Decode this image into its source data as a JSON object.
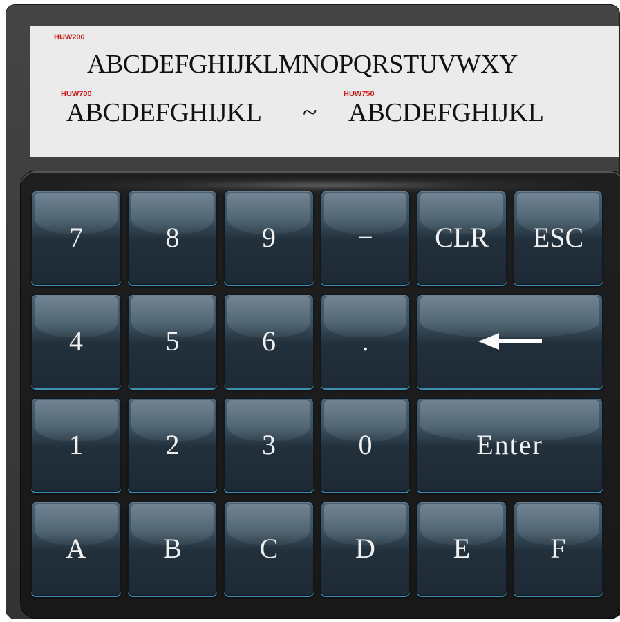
{
  "display": {
    "line1_tag": "HUW200",
    "line1_text": "ABCDEFGHIJKLMNOPQRSTUVWXY",
    "line2_left_tag": "HUW700",
    "line2_left_text": "ABCDEFGHIJKL",
    "line2_separator": "~",
    "line2_right_tag": "HUW750",
    "line2_right_text": "ABCDEFGHIJKL"
  },
  "keys": {
    "k7": "7",
    "k8": "8",
    "k9": "9",
    "minus": "−",
    "clr": "CLR",
    "esc": "ESC",
    "k4": "4",
    "k5": "5",
    "k6": "6",
    "dot": ".",
    "backspace_icon": "left-arrow-icon",
    "k1": "1",
    "k2": "2",
    "k3": "3",
    "k0": "0",
    "enter": "Enter",
    "a": "A",
    "b": "B",
    "c": "C",
    "d": "D",
    "e": "E",
    "f": "F"
  },
  "colors": {
    "display_bg": "#ebebeb",
    "tag_red": "#e01010",
    "key_bottom_accent": "#3c8fb3"
  }
}
